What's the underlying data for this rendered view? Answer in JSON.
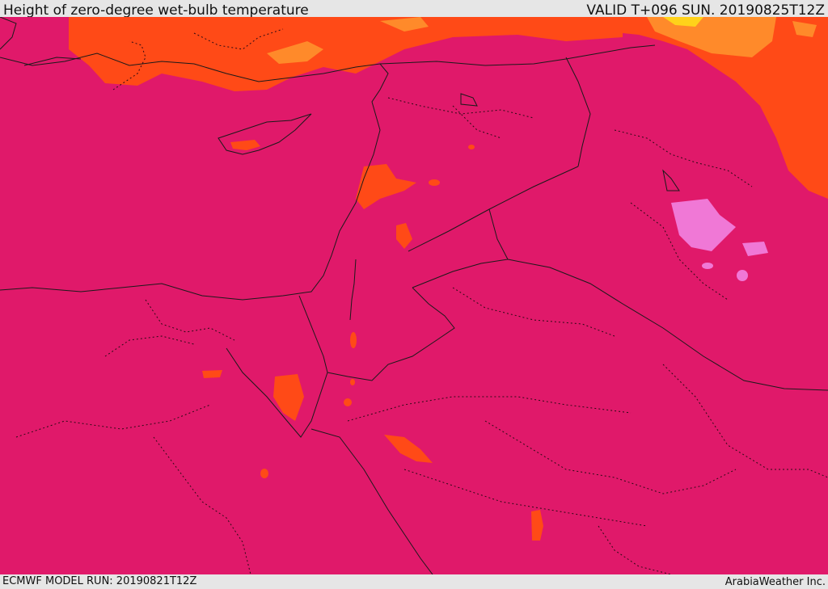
{
  "header": {
    "title": "Height of zero-degree wet-bulb temperature",
    "valid": "VALID T+096 SUN. 20190825T12Z"
  },
  "footer": {
    "model_run": "ECMWF MODEL RUN: 20190821T12Z",
    "credit": "ArabiaWeather Inc."
  },
  "colors": {
    "base_band": "#e0196a",
    "warm_band": "#ff4a17",
    "warmer_band": "#ff8a2a",
    "hot_band": "#ffd21a",
    "cool_band": "#f078d6",
    "border_line": "#1a1a1a"
  }
}
